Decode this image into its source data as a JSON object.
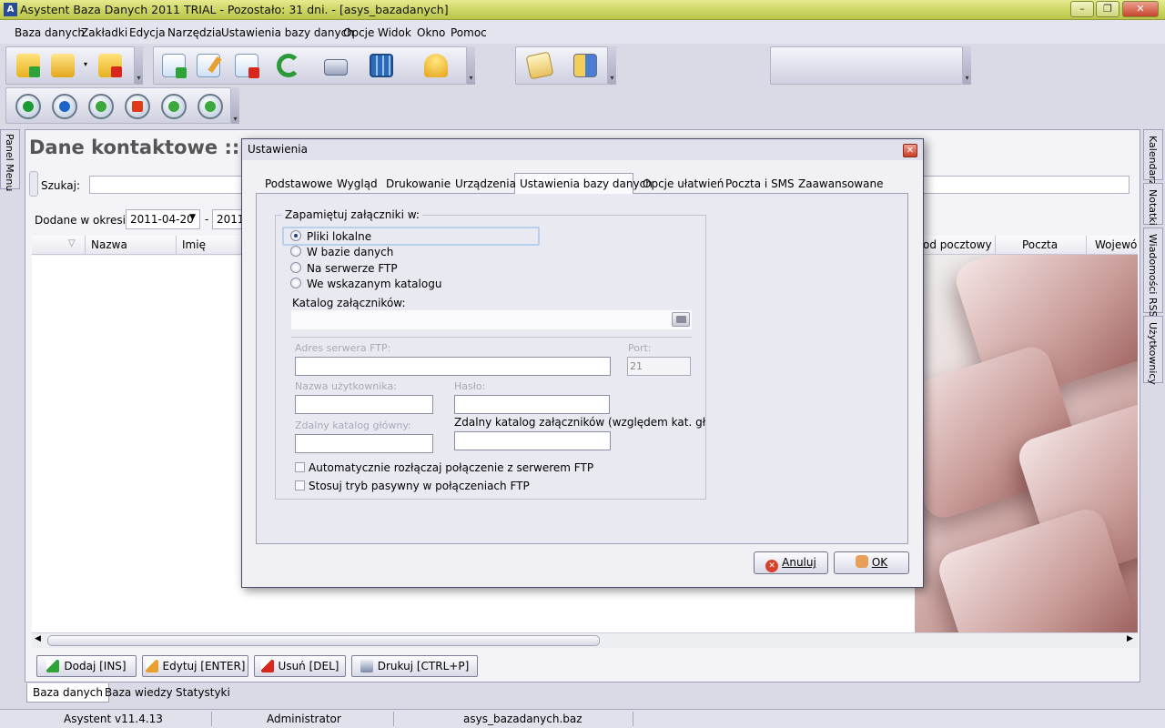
{
  "window": {
    "title": "Asystent Baza Danych 2011 TRIAL - Pozostało: 31 dni. - [asys_bazadanych]",
    "min": "–",
    "max": "❐",
    "close": "✕"
  },
  "menu": [
    "Baza danych",
    "Zakładki",
    "Edycja",
    "Narzędzia",
    "Ustawienia bazy danych",
    "Opcje",
    "Widok",
    "Okno",
    "Pomoc"
  ],
  "toolbar": {
    "icons": [
      "new-folder-icon",
      "open-folder-icon",
      "delete-folder-icon",
      "add-document-icon",
      "edit-document-icon",
      "delete-document-icon",
      "refresh-icon",
      "print-icon",
      "calculator-icon",
      "bell-icon",
      "send-mail-icon",
      "address-book-icon"
    ],
    "player": [
      "add-circle-icon",
      "play-icon",
      "pause-icon",
      "stop-icon",
      "rewind-icon",
      "forward-icon"
    ]
  },
  "side_left": {
    "panel_menu": "Panel Menu"
  },
  "side_right": [
    "Kalendarz",
    "Notatki",
    "Wiadomości RSS",
    "Użytkownicy"
  ],
  "main": {
    "title": "Dane kontaktowe :: W",
    "search_label": "Szukaj:",
    "period_label": "Dodane w okresie:",
    "date_from": "2011-04-20",
    "date_to": "2011-",
    "date_sep": "-",
    "columns": [
      "Nazwa",
      "Imię",
      "od pocztowy",
      "Poczta",
      "Wojewó"
    ],
    "buttons": {
      "add": "Dodaj [INS]",
      "edit": "Edytuj [ENTER]",
      "delete": "Usuń [DEL]",
      "print": "Drukuj [CTRL+P]"
    },
    "tabs": [
      "Baza danych",
      "Baza wiedzy",
      "Statystyki"
    ]
  },
  "status": {
    "version": "Asystent v11.4.13",
    "user": "Administrator",
    "file": "asys_bazadanych.baz"
  },
  "dialog": {
    "title": "Ustawienia",
    "close": "✕",
    "tabs": [
      "Podstawowe",
      "Wygląd",
      "Drukowanie",
      "Urządzenia",
      "Ustawienia bazy danych",
      "Opcje ułatwień",
      "Poczta i SMS",
      "Zaawansowane"
    ],
    "group_title": "Zapamiętuj załączniki w:",
    "radios": [
      "Pliki lokalne",
      "W bazie danych",
      "Na serwerze FTP",
      "We wskazanym katalogu"
    ],
    "selected_radio": "Pliki lokalne",
    "catalog_label": "Katalog załączników:",
    "ftp_address_label": "Adres serwera FTP:",
    "port_label": "Port:",
    "port_value": "21",
    "username_label": "Nazwa użytkownika:",
    "password_label": "Hasło:",
    "remote_root_label": "Zdalny katalog główny:",
    "remote_attach_label": "Zdalny katalog załączników (względem kat. głównego",
    "check_autodisconnect": "Automatycznie rozłączaj połączenie z serwerem FTP",
    "check_passive": "Stosuj tryb pasywny w połączeniach FTP",
    "cancel": "Anuluj",
    "ok": "OK"
  }
}
